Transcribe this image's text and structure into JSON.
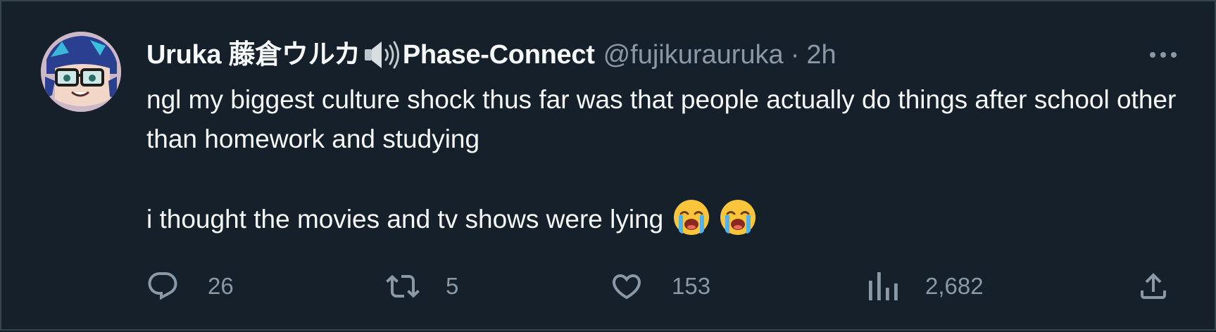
{
  "tweet": {
    "display_name": "Uruka 藤倉ウルカ",
    "display_name_suffix": "Phase-Connect",
    "handle": "@fujikurauruka",
    "separator": "·",
    "time": "2h",
    "text_line_1": "ngl my biggest culture shock thus far was that people actually do things after school other than homework and studying",
    "text_line_2": "i thought the movies and tv shows were lying"
  },
  "icons": {
    "avatar": "avatar-image",
    "speaker": "speaker-volume-icon",
    "more": "more-horizontal-icon",
    "emoji": "loudly-crying-face-emoji",
    "reply": "reply-icon",
    "retweet": "retweet-icon",
    "like": "heart-icon",
    "views": "views-bar-chart-icon",
    "share": "share-icon"
  },
  "actions": {
    "reply_count": "26",
    "retweet_count": "5",
    "like_count": "153",
    "views_count": "2,682"
  },
  "colors": {
    "background": "#15202b",
    "text_primary": "#f7f9f9",
    "text_secondary": "#8b98a5",
    "border": "#38444d"
  }
}
